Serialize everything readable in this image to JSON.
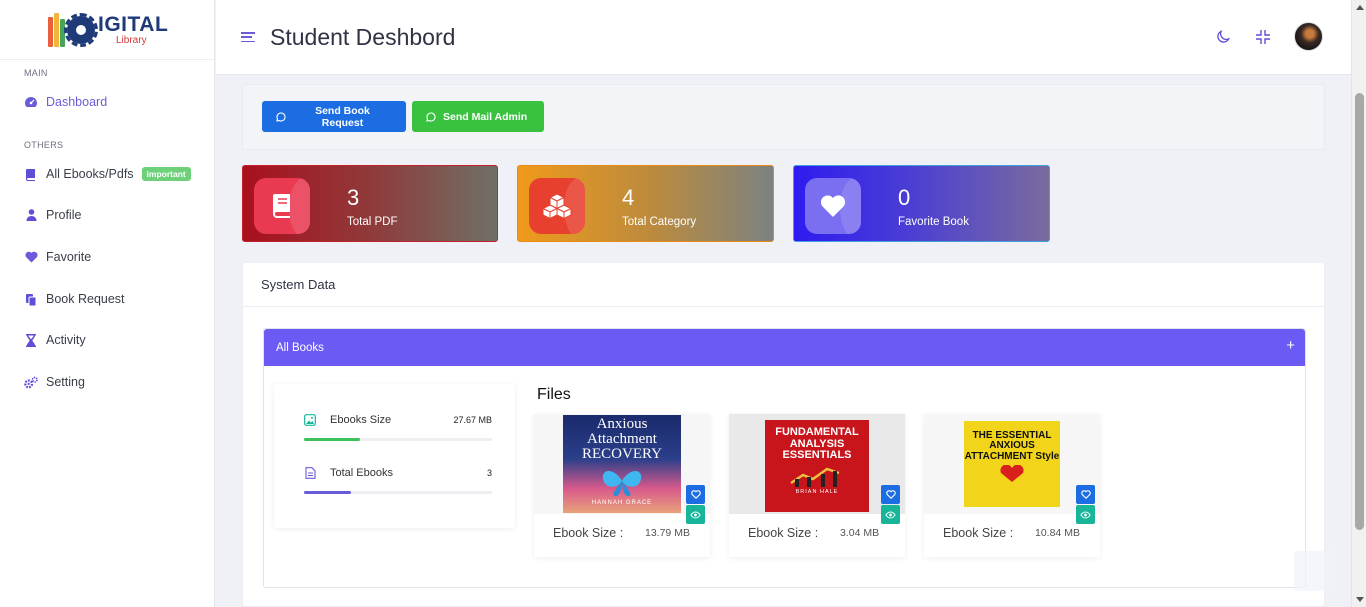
{
  "logo": {
    "text": "IGITAL",
    "subtext": "Library"
  },
  "sidebar": {
    "section_main": "MAIN",
    "section_others": "OTHERS",
    "items": [
      {
        "label": "Dashboard",
        "icon": "dashboard-gauge-icon"
      },
      {
        "label": "All Ebooks/Pdfs",
        "icon": "book-icon",
        "badge": "important"
      },
      {
        "label": "Profile",
        "icon": "user-icon"
      },
      {
        "label": "Favorite",
        "icon": "heart-icon"
      },
      {
        "label": "Book Request",
        "icon": "copy-icon"
      },
      {
        "label": "Activity",
        "icon": "hourglass-icon"
      },
      {
        "label": "Setting",
        "icon": "gears-icon"
      }
    ]
  },
  "header": {
    "title": "Student Deshbord"
  },
  "actions": {
    "send_book_request": "Send Book Request",
    "send_mail_admin": "Send Mail Admin"
  },
  "stats": [
    {
      "value": "3",
      "label": "Total PDF",
      "icon": "book-icon"
    },
    {
      "value": "4",
      "label": "Total Category",
      "icon": "cubes-icon"
    },
    {
      "value": "0",
      "label": "Favorite Book",
      "icon": "heart-icon"
    }
  ],
  "system_data": {
    "title": "System Data",
    "accordion_title": "All Books",
    "ebooks_size_label": "Ebooks Size",
    "ebooks_size_value": "27.67 MB",
    "total_ebooks_label": "Total Ebooks",
    "total_ebooks_value": "3",
    "ebooks_size_progress": 0.3,
    "total_ebooks_progress": 0.25,
    "files_title": "Files",
    "files": [
      {
        "size_label": "Ebook Size :",
        "size": "13.79 MB",
        "cover_title": "Anxious Attachment RECOVERY",
        "cover_author": "HANNAH GRACE"
      },
      {
        "size_label": "Ebook Size :",
        "size": "3.04 MB",
        "cover_title": "FUNDAMENTAL ANALYSIS ESSENTIALS",
        "cover_author": "BRIAN HALE"
      },
      {
        "size_label": "Ebook Size :",
        "size": "10.84 MB",
        "cover_title": "THE ESSENTIAL ANXIOUS ATTACHMENT Style",
        "cover_author": ""
      }
    ]
  },
  "colors": {
    "accent": "#6b5bf4",
    "blue": "#1d6de2",
    "green": "#39c23f",
    "teal": "#18b59a"
  }
}
